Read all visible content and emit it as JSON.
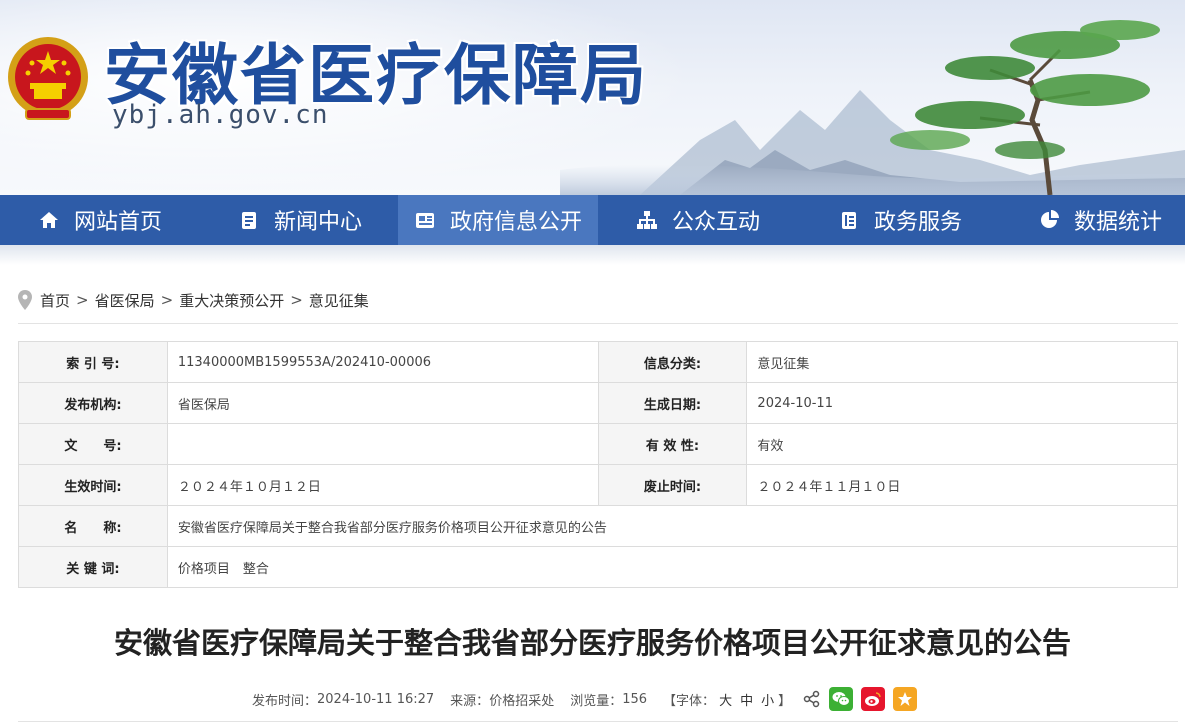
{
  "header": {
    "site_title": "安徽省医疗保障局",
    "site_domain": "ybj.ah.gov.cn",
    "emblem_icon": "national-emblem-icon"
  },
  "nav": {
    "items": [
      {
        "label": "网站首页",
        "icon": "home-icon"
      },
      {
        "label": "新闻中心",
        "icon": "document-icon"
      },
      {
        "label": "政府信息公开",
        "icon": "newspaper-icon",
        "active": true
      },
      {
        "label": "公众互动",
        "icon": "sitemap-icon"
      },
      {
        "label": "政务服务",
        "icon": "clipboard-icon"
      },
      {
        "label": "数据统计",
        "icon": "pie-chart-icon"
      }
    ],
    "bg_color": "#2e5ca8",
    "active_color": "#4a77bf"
  },
  "breadcrumb": {
    "items": [
      "首页",
      "省医保局",
      "重大决策预公开",
      "意见征集"
    ],
    "separator": ">"
  },
  "info_table": {
    "index_label": "索 引 号:",
    "index_value": "11340000MB1599553A/202410-00006",
    "category_label": "信息分类:",
    "category_value": "意见征集",
    "publisher_label": "发布机构:",
    "publisher_value": "省医保局",
    "created_label": "生成日期:",
    "created_value": "2024-10-11",
    "docno_label": "文　　号:",
    "docno_value": "",
    "validity_label": "有 效 性:",
    "validity_value": "有效",
    "effective_label": "生效时间:",
    "effective_value": "２０２４年１０月１２日",
    "expire_label": "废止时间:",
    "expire_value": "２０２４年１１月１０日",
    "name_label": "名　　称:",
    "name_value": "安徽省医疗保障局关于整合我省部分医疗服务价格项目公开征求意见的公告",
    "keywords_label": "关 键 词:",
    "keywords_value": "价格项目　整合"
  },
  "article": {
    "title": "安徽省医疗保障局关于整合我省部分医疗服务价格项目公开征求意见的公告",
    "publish_label": "发布时间：",
    "publish_time": "2024-10-11 16:27",
    "source_label": "来源：",
    "source_value": "价格招采处",
    "views_label": "浏览量：",
    "views_value": "156",
    "font_open": "【字体：",
    "font_large": "大",
    "font_medium": "中",
    "font_small": "小",
    "font_close": "】"
  },
  "share": {
    "icons": [
      "share-icon",
      "wechat-icon",
      "weibo-icon",
      "favorite-icon"
    ],
    "wechat_color": "#3cb034",
    "weibo_color": "#e6162d",
    "favorite_color": "#f5a623"
  }
}
